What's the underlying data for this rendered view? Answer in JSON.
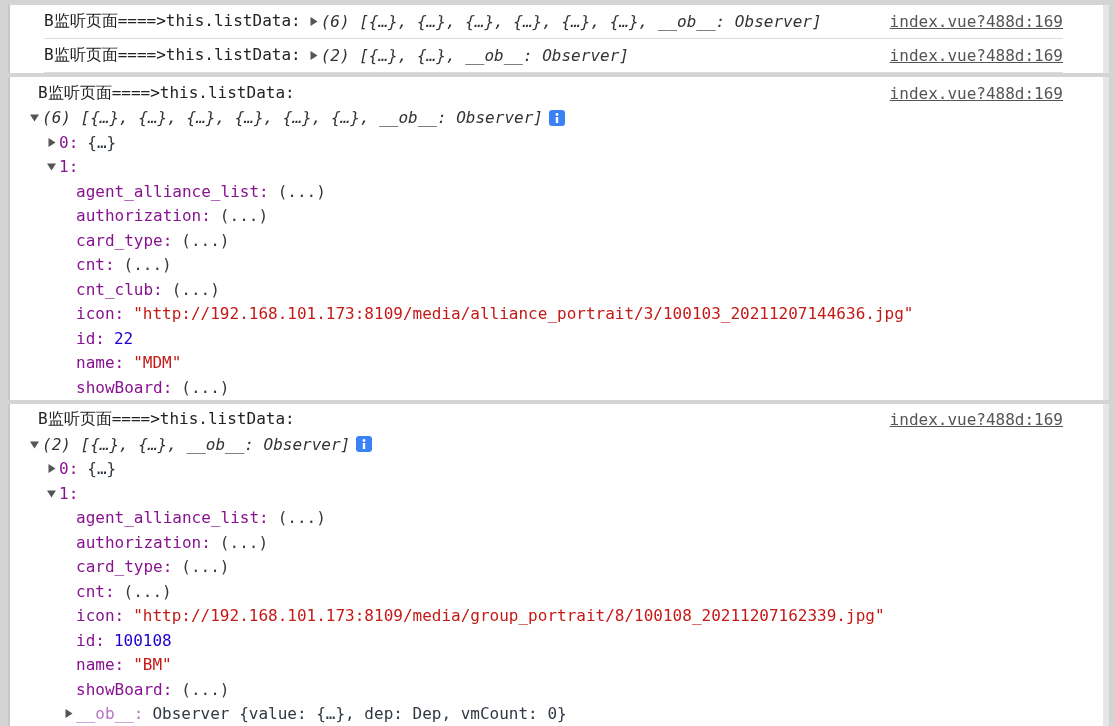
{
  "panels": [
    {
      "entries": [
        {
          "label": "B监听页面====>this.listData:",
          "summary": "(6) [{…}, {…}, {…}, {…}, {…}, {…}, __ob__: Observer]",
          "expanded": false,
          "source": "index.vue?488d:169"
        },
        {
          "label": "B监听页面====>this.listData:",
          "summary": "(2) [{…}, {…}, __ob__: Observer]",
          "expanded": false,
          "source": "index.vue?488d:169"
        }
      ]
    },
    {
      "entries": [
        {
          "label": "B监听页面====>this.listData:",
          "summary": "(6) [{…}, {…}, {…}, {…}, {…}, {…}, __ob__: Observer]",
          "expanded": true,
          "source": "index.vue?488d:169",
          "children": [
            {
              "key": "0:",
              "value": "{…}",
              "kind": "object",
              "dimmed": false,
              "expanded": false
            },
            {
              "key": "1:",
              "kind": "object",
              "dimmed": false,
              "expanded": true,
              "children": [
                {
                  "key": "agent_alliance_list:",
                  "value": "(...)",
                  "kind": "lazy",
                  "dimmed": false
                },
                {
                  "key": "authorization:",
                  "value": "(...)",
                  "kind": "lazy",
                  "dimmed": false
                },
                {
                  "key": "card_type:",
                  "value": "(...)",
                  "kind": "lazy",
                  "dimmed": false
                },
                {
                  "key": "cnt:",
                  "value": "(...)",
                  "kind": "lazy",
                  "dimmed": false
                },
                {
                  "key": "cnt_club:",
                  "value": "(...)",
                  "kind": "lazy",
                  "dimmed": false
                },
                {
                  "key": "icon:",
                  "value": "\"http://192.168.101.173:8109/media/alliance_portrait/3/100103_20211207144636.jpg\"",
                  "kind": "string",
                  "dimmed": false
                },
                {
                  "key": "id:",
                  "value": "22",
                  "kind": "number",
                  "dimmed": false
                },
                {
                  "key": "name:",
                  "value": "\"MDM\"",
                  "kind": "string",
                  "dimmed": false
                },
                {
                  "key": "showBoard:",
                  "value": "(...)",
                  "kind": "lazy",
                  "dimmed": false
                }
              ]
            }
          ]
        }
      ]
    },
    {
      "entries": [
        {
          "label": "B监听页面====>this.listData:",
          "summary": "(2) [{…}, {…}, __ob__: Observer]",
          "expanded": true,
          "source": "index.vue?488d:169",
          "children": [
            {
              "key": "0:",
              "value": "{…}",
              "kind": "object",
              "dimmed": false,
              "expanded": false
            },
            {
              "key": "1:",
              "kind": "object",
              "dimmed": false,
              "expanded": true,
              "children": [
                {
                  "key": "agent_alliance_list:",
                  "value": "(...)",
                  "kind": "lazy",
                  "dimmed": false
                },
                {
                  "key": "authorization:",
                  "value": "(...)",
                  "kind": "lazy",
                  "dimmed": false
                },
                {
                  "key": "card_type:",
                  "value": "(...)",
                  "kind": "lazy",
                  "dimmed": false
                },
                {
                  "key": "cnt:",
                  "value": "(...)",
                  "kind": "lazy",
                  "dimmed": false
                },
                {
                  "key": "icon:",
                  "value": "\"http://192.168.101.173:8109/media/group_portrait/8/100108_20211207162339.jpg\"",
                  "kind": "string",
                  "dimmed": false
                },
                {
                  "key": "id:",
                  "value": "100108",
                  "kind": "number",
                  "dimmed": false
                },
                {
                  "key": "name:",
                  "value": "\"BM\"",
                  "kind": "string",
                  "dimmed": false
                },
                {
                  "key": "showBoard:",
                  "value": "(...)",
                  "kind": "lazy",
                  "dimmed": false
                },
                {
                  "key": "__ob__:",
                  "value": "Observer {value: {…}, dep: Dep, vmCount: 0}",
                  "kind": "object",
                  "dimmed": true,
                  "expanded": false
                }
              ]
            }
          ]
        }
      ]
    }
  ]
}
